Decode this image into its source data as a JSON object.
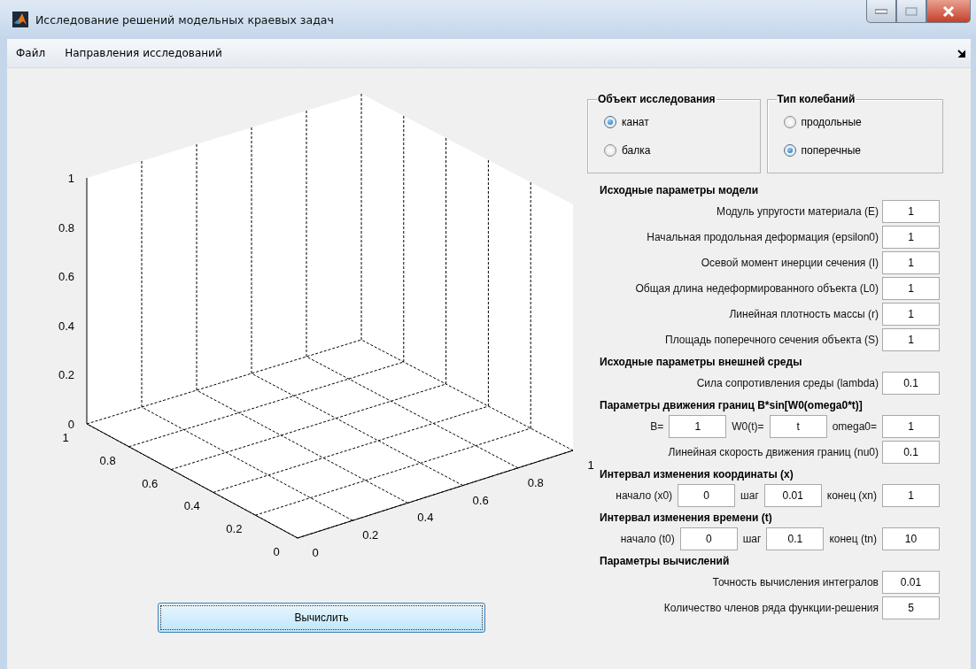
{
  "window": {
    "title": "Исследование решений модельных краевых задач"
  },
  "menu": [
    {
      "label": "Файл"
    },
    {
      "label": "Направления исследований"
    }
  ],
  "plot": {
    "z_ticks": [
      "1",
      "0.8",
      "0.6",
      "0.4",
      "0.2",
      "0"
    ],
    "y_ticks": [
      "1",
      "0.8",
      "0.6",
      "0.4",
      "0.2",
      "0"
    ],
    "x_ticks": [
      "0",
      "0.2",
      "0.4",
      "0.6",
      "0.8",
      "1"
    ]
  },
  "groups": [
    {
      "title": "Объект исследования",
      "options": [
        {
          "label": "канат",
          "selected": true
        },
        {
          "label": "балка",
          "selected": false
        }
      ]
    },
    {
      "title": "Тип колебаний",
      "options": [
        {
          "label": "продольные",
          "selected": false
        },
        {
          "label": "поперечные",
          "selected": true
        }
      ]
    }
  ],
  "sections": [
    {
      "title": "Исходные параметры модели",
      "rows": [
        {
          "kind": "field",
          "label": "Модуль упругости материала (E)",
          "value": "1"
        },
        {
          "kind": "field",
          "label": "Начальная продольная деформация (epsilon0)",
          "value": "1"
        },
        {
          "kind": "field",
          "label": "Осевой момент инерции сечения (I)",
          "value": "1"
        },
        {
          "kind": "field",
          "label": "Общая длина недеформированного объекта (L0)",
          "value": "1"
        },
        {
          "kind": "field",
          "label": "Линейная плотность массы (r)",
          "value": "1"
        },
        {
          "kind": "field",
          "label": "Площадь поперечного сечения объекта (S)",
          "value": "1"
        }
      ]
    },
    {
      "title": "Исходные параметры внешней среды",
      "rows": [
        {
          "kind": "field",
          "label": "Сила сопротивления среды (lambda)",
          "value": "0.1"
        }
      ]
    },
    {
      "title": "Параметры движения границ B*sin[W0(omega0*t)]",
      "rows": [
        {
          "kind": "triple",
          "pairs": [
            {
              "label": "B=",
              "value": "1"
            },
            {
              "label": "W0(t)=",
              "value": "t"
            },
            {
              "label": "omega0=",
              "value": "1"
            }
          ]
        },
        {
          "kind": "field",
          "label": "Линейная скорость движения границ (nu0)",
          "value": "0.1"
        }
      ]
    },
    {
      "title": "Интервал изменения координаты (x)",
      "rows": [
        {
          "kind": "triple",
          "pairs": [
            {
              "label": "начало (x0)",
              "value": "0"
            },
            {
              "label": "шаг",
              "value": "0.01"
            },
            {
              "label": "конец (xn)",
              "value": "1"
            }
          ]
        }
      ]
    },
    {
      "title": "Интервал изменения времени (t)",
      "rows": [
        {
          "kind": "triple",
          "pairs": [
            {
              "label": "начало (t0)",
              "value": "0"
            },
            {
              "label": "шаг",
              "value": "0.1"
            },
            {
              "label": "конец (tn)",
              "value": "10"
            }
          ]
        }
      ]
    },
    {
      "title": "Параметры вычислений",
      "rows": [
        {
          "kind": "field",
          "label": "Точность вычисления интегралов",
          "value": "0.01"
        },
        {
          "kind": "field",
          "label": "Количество членов ряда функции-решения",
          "value": "5"
        }
      ]
    }
  ],
  "compute_button": "Вычислить"
}
